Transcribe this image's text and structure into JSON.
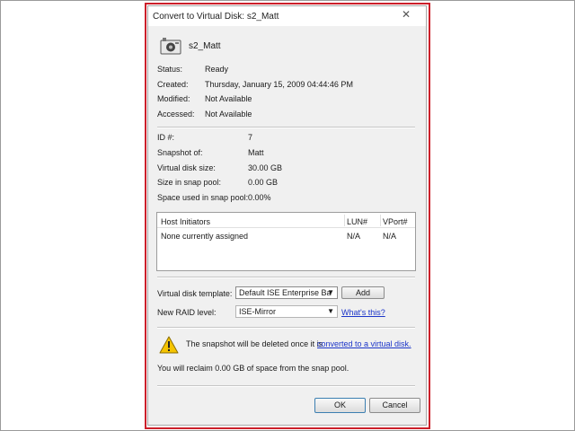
{
  "window": {
    "title": "Convert to Virtual Disk: s2_Matt",
    "close_glyph": "✕"
  },
  "disk": {
    "icon": "snapshot-disk-icon",
    "name": "s2_Matt"
  },
  "details": [
    {
      "label": "Status:",
      "value": "Ready"
    },
    {
      "label": "Created:",
      "value": "Thursday, January 15, 2009  04:44:46 PM"
    },
    {
      "label": "Modified:",
      "value": "Not Available"
    },
    {
      "label": "Accessed:",
      "value": "Not Available"
    }
  ],
  "properties": [
    {
      "label": "ID #:",
      "value": "7"
    },
    {
      "label": "Snapshot of:",
      "value": "Matt"
    },
    {
      "label": "Virtual disk size:",
      "value": "30.00 GB"
    },
    {
      "label": "Size in snap pool:",
      "value": "0.00 GB"
    },
    {
      "label": "Space used in snap pool:",
      "value": "0.00%"
    }
  ],
  "host_table": {
    "headers": [
      "Host Initiators",
      "LUN#",
      "VPort#"
    ],
    "rows": [
      [
        "None currently assigned",
        "N/A",
        "N/A"
      ]
    ]
  },
  "template": {
    "label": "Virtual disk template:",
    "value": "Default ISE Enterprise Ba",
    "add_label": "Add"
  },
  "raid": {
    "label": "New RAID level:",
    "value": "ISE-Mirror",
    "help_link": "What's this?"
  },
  "warning": {
    "icon": "warning-icon",
    "text": "The snapshot will be deleted once it is",
    "link": "converted to a virtual disk.",
    "reclaim": "You will reclaim 0.00 GB of space from the snap pool."
  },
  "buttons": {
    "ok": "OK",
    "cancel": "Cancel"
  },
  "colors": {
    "highlight": "#cc1f2a",
    "link": "#1b35c9",
    "warning": "#f5c400"
  }
}
